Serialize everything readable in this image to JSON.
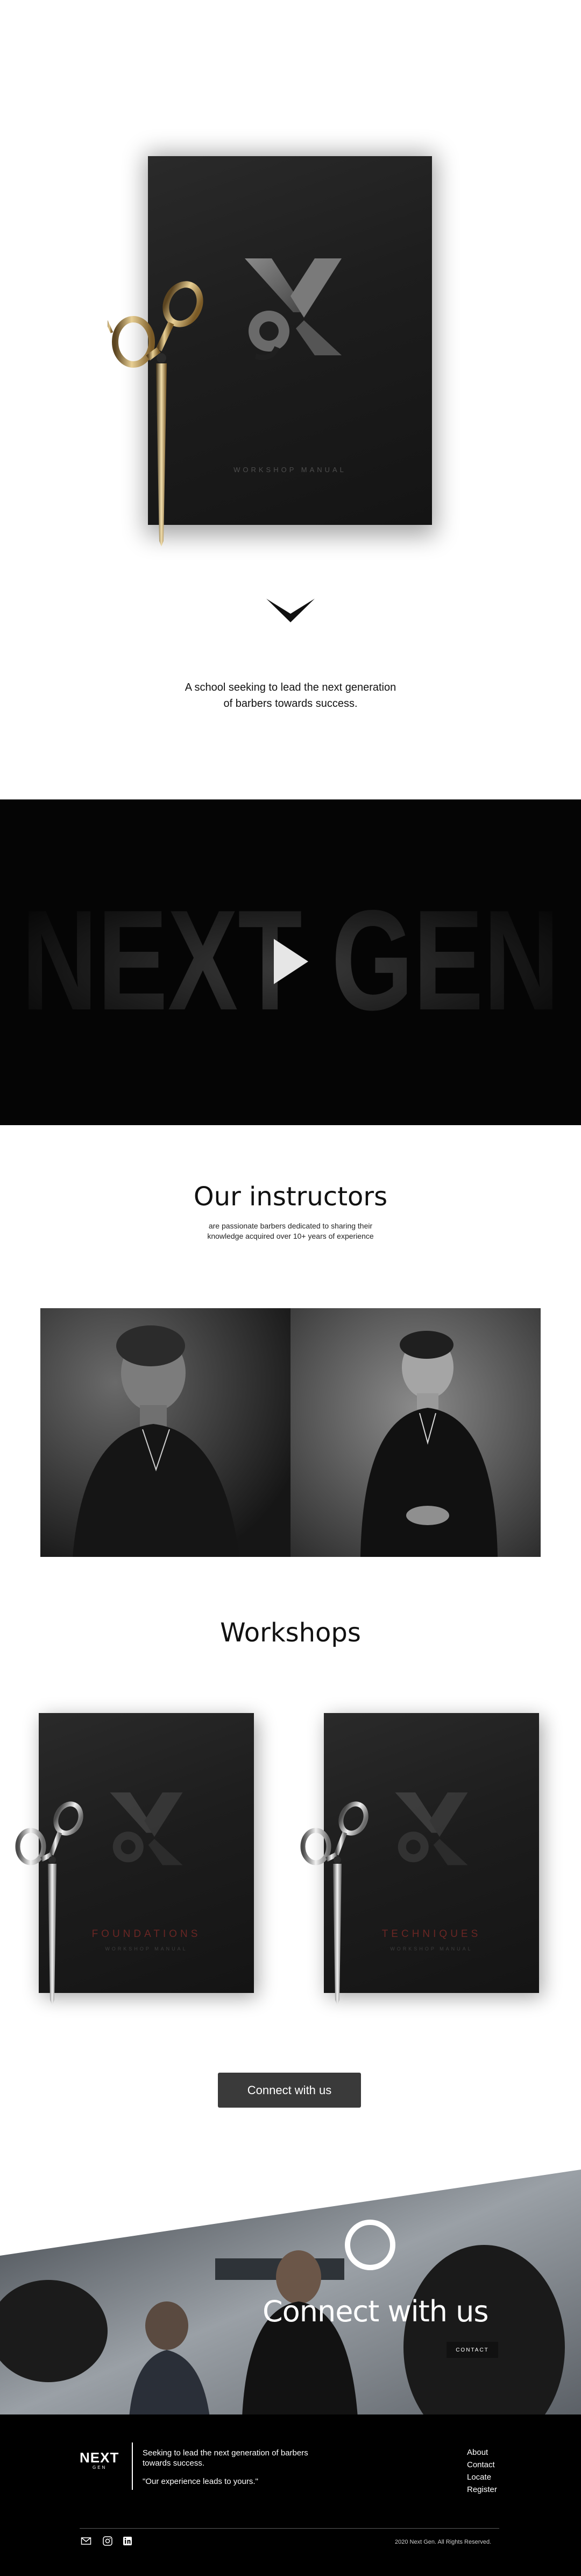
{
  "hero": {
    "manual_title": "WORKSHOP MANUAL"
  },
  "tagline": {
    "line1": "A school seeking to lead the next generation",
    "line2": "of barbers towards success."
  },
  "video": {
    "title_text": "NEXT GEN"
  },
  "instructors": {
    "title": "Our instructors",
    "subtitle_line1": "are passionate barbers dedicated to sharing their",
    "subtitle_line2": "knowledge acquired over 10+ years of experience"
  },
  "workshops": {
    "title": "Workshops",
    "items": [
      {
        "name": "FOUNDATIONS",
        "subtitle": "WORKSHOP MANUAL"
      },
      {
        "name": "TECHNIQUES",
        "subtitle": "WORKSHOP MANUAL"
      }
    ],
    "cta_label": "Connect with us"
  },
  "banner": {
    "title": "Connect with us",
    "contact_label": "CONTACT"
  },
  "footer": {
    "logo_main": "NEXT",
    "logo_sub": "GEN",
    "description_line1": "Seeking to lead the next generation of barbers",
    "description_line2": "towards success.",
    "quote": "\"Our experience leads to yours.\"",
    "links": [
      "About",
      "Contact",
      "Locate",
      "Register"
    ],
    "social_icons": [
      "mail-icon",
      "instagram-icon",
      "linkedin-icon"
    ],
    "copyright": "2020 Next Gen. All Rights Reserved."
  },
  "colors": {
    "accent_red": "#6a2624",
    "dark_bg": "#000000",
    "button_bg": "#3a3a3a"
  }
}
